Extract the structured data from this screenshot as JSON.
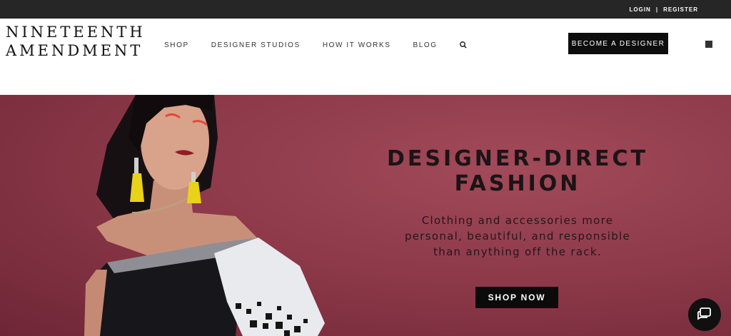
{
  "topbar": {
    "login_label": "LOGIN",
    "separator": "|",
    "register_label": "REGISTER"
  },
  "header": {
    "logo_line1": "NINETEENTH",
    "logo_line2": "AMENDMENT",
    "nav": {
      "shop": "SHOP",
      "designer_studios": "DESIGNER STUDIOS",
      "how_it_works": "HOW IT WORKS",
      "blog": "BLOG"
    },
    "cta_label": "BECOME A DESIGNER"
  },
  "hero": {
    "headline_line1": "DESIGNER-DIRECT",
    "headline_line2": "FASHION",
    "subtitle_line1": "Clothing and accessories more",
    "subtitle_line2": "personal, beautiful, and responsible",
    "subtitle_line3": "than anything off the rack.",
    "button_label": "SHOP NOW"
  },
  "colors": {
    "topbar_bg": "#262626",
    "hero_bg": "#8e3a4a",
    "button_bg": "#0d0d0d",
    "earring_yellow": "#e8d21a"
  },
  "icons": {
    "search": "search-icon",
    "cart": "cart-icon",
    "chat": "chat-icon"
  }
}
